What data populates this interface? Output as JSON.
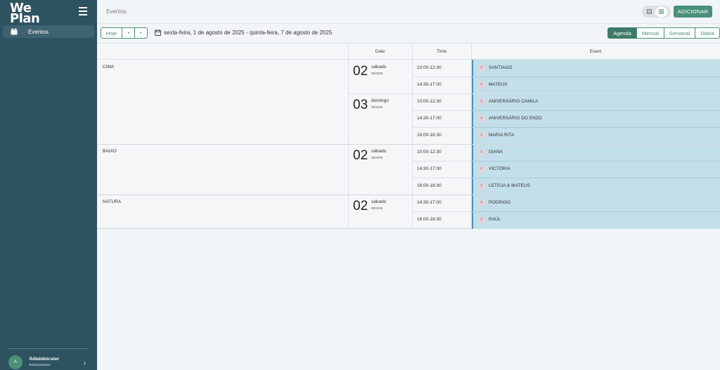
{
  "brand": {
    "logo_line1": "We",
    "logo_line2": "Plan"
  },
  "sidebar": {
    "items": [
      {
        "label": "Eventos",
        "icon": "calendar-icon",
        "active": true
      }
    ],
    "user": {
      "initial": "A",
      "name": "Administrator",
      "role": "Administrator"
    }
  },
  "header": {
    "title": "Eventos",
    "add_label": "ADICIONAR"
  },
  "toolbar": {
    "today_label": "Hoje",
    "prev_label": "◂",
    "next_label": "▸",
    "range_text": "sexta-feira, 1 de agosto de 2025 - quinta-feira, 7 de agosto de 2025",
    "modes": [
      "Agenda",
      "Mensal",
      "Semanal",
      "Diária"
    ],
    "active_mode": "Agenda"
  },
  "agenda": {
    "headers": {
      "date": "Date",
      "time": "Time",
      "event": "Event"
    },
    "groups": [
      {
        "location": "CIMA",
        "days": [
          {
            "day": "02",
            "weekday": "sábado",
            "month": "08/2025",
            "events": [
              {
                "time": "10:00-12:30",
                "badge": "F",
                "name": "SANTIAGO"
              },
              {
                "time": "14:30-17:00",
                "badge": "F",
                "name": "MATEUS"
              }
            ]
          },
          {
            "day": "03",
            "weekday": "domingo",
            "month": "08/2025",
            "events": [
              {
                "time": "10:00-12:30",
                "badge": "F",
                "name": "ANIVERSÁRIO CAMILA"
              },
              {
                "time": "14:30-17:00",
                "badge": "F",
                "name": "ANIVERSÁRIO DO ENZO"
              },
              {
                "time": "16:00-18:30",
                "badge": "F",
                "name": "MARIA RITA"
              }
            ]
          }
        ]
      },
      {
        "location": "BAIXO",
        "days": [
          {
            "day": "02",
            "weekday": "sábado",
            "month": "08/2025",
            "events": [
              {
                "time": "10:00-12:30",
                "badge": "F",
                "name": "DIANA"
              },
              {
                "time": "14:30-17:00",
                "badge": "F",
                "name": "VICTÓRIA"
              },
              {
                "time": "16:00-18:30",
                "badge": "F",
                "name": "LETÍCIA & MATEUS"
              }
            ]
          }
        ]
      },
      {
        "location": "NATURA",
        "days": [
          {
            "day": "02",
            "weekday": "sábado",
            "month": "08/2025",
            "events": [
              {
                "time": "14:30-17:00",
                "badge": "F",
                "name": "RODRIGO"
              },
              {
                "time": "16:00-18:30",
                "badge": "F",
                "name": "RAÚL"
              }
            ]
          }
        ]
      }
    ]
  },
  "colors": {
    "sidebar": "#2f5260",
    "accent": "#4a8f7a",
    "event_bg": "#c2dfea",
    "event_bar": "#4f8fc0"
  }
}
